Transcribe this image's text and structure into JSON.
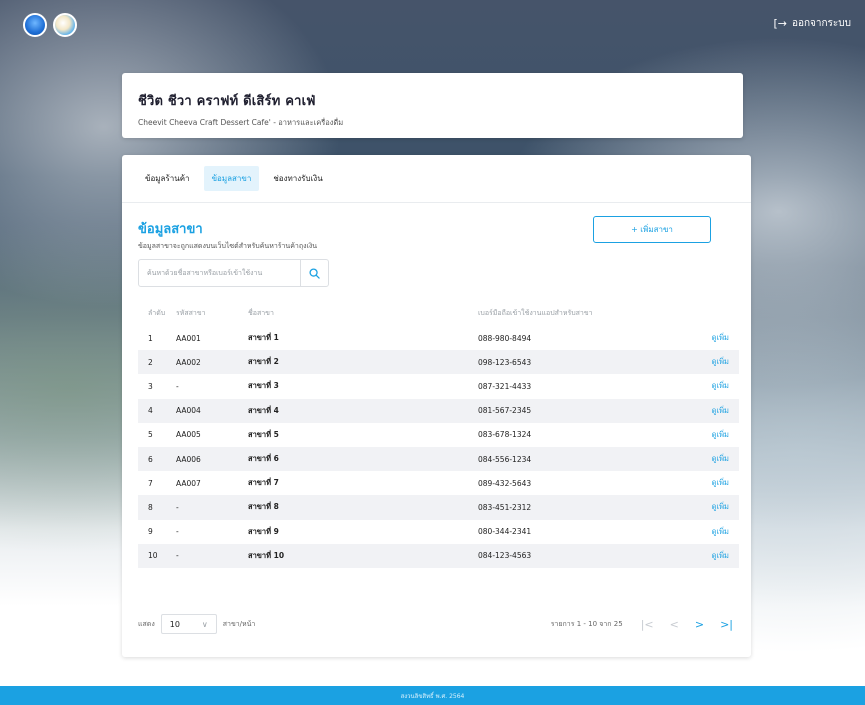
{
  "header": {
    "logout_label": "ออกจากระบบ"
  },
  "shop": {
    "title": "ชีวิต ชีวา คราฟท์ ดีเสิร์ท คาเฟ่",
    "subtitle": "Cheevit Cheeva Craft Dessert Cafe' - อาหารและเครื่องดื่ม"
  },
  "tabs": [
    {
      "label": "ข้อมูลร้านค้า",
      "active": false
    },
    {
      "label": "ข้อมูลสาขา",
      "active": true
    },
    {
      "label": "ช่องทางรับเงิน",
      "active": false
    }
  ],
  "section": {
    "title": "ข้อมูลสาขา",
    "description": "ข้อมูลสาขาจะถูกแสดงบนเว็บไซต์สำหรับค้นหาร้านค้าถุงเงิน",
    "add_button": "+ เพิ่มสาขา"
  },
  "search": {
    "placeholder": "ค้นหาด้วยชื่อสาขาหรือเบอร์เข้าใช้งาน"
  },
  "table": {
    "headers": [
      "ลำดับ",
      "รหัสสาขา",
      "ชื่อสาขา",
      "เบอร์มือถือเข้าใช้งานแอปสำหรับสาขา",
      ""
    ],
    "rows": [
      {
        "no": "1",
        "code": "AA001",
        "name": "สาขาที่ 1",
        "phone": "088-980-8494",
        "action": "ดูเพิ่ม"
      },
      {
        "no": "2",
        "code": "AA002",
        "name": "สาขาที่ 2",
        "phone": "098-123-6543",
        "action": "ดูเพิ่ม"
      },
      {
        "no": "3",
        "code": "-",
        "name": "สาขาที่ 3",
        "phone": "087-321-4433",
        "action": "ดูเพิ่ม"
      },
      {
        "no": "4",
        "code": "AA004",
        "name": "สาขาที่ 4",
        "phone": "081-567-2345",
        "action": "ดูเพิ่ม"
      },
      {
        "no": "5",
        "code": "AA005",
        "name": "สาขาที่ 5",
        "phone": "083-678-1324",
        "action": "ดูเพิ่ม"
      },
      {
        "no": "6",
        "code": "AA006",
        "name": "สาขาที่ 6",
        "phone": "084-556-1234",
        "action": "ดูเพิ่ม"
      },
      {
        "no": "7",
        "code": "AA007",
        "name": "สาขาที่ 7",
        "phone": "089-432-5643",
        "action": "ดูเพิ่ม"
      },
      {
        "no": "8",
        "code": "-",
        "name": "สาขาที่ 8",
        "phone": "083-451-2312",
        "action": "ดูเพิ่ม"
      },
      {
        "no": "9",
        "code": "-",
        "name": "สาขาที่ 9",
        "phone": "080-344-2341",
        "action": "ดูเพิ่ม"
      },
      {
        "no": "10",
        "code": "-",
        "name": "สาขาที่ 10",
        "phone": "084-123-4563",
        "action": "ดูเพิ่ม"
      }
    ]
  },
  "pagination": {
    "show_label": "แสดง",
    "page_size": "10",
    "per_page_label": "สาขา/หน้า",
    "range_text": "รายการ 1 - 10 จาก 25",
    "first": "|<",
    "prev": "<",
    "next": ">",
    "last": ">|"
  },
  "footer": {
    "copyright": "สงวนลิขสิทธิ์ พ.ศ. 2564"
  },
  "colors": {
    "accent": "#1ba1e2",
    "row_alt": "#f1f2f5"
  }
}
